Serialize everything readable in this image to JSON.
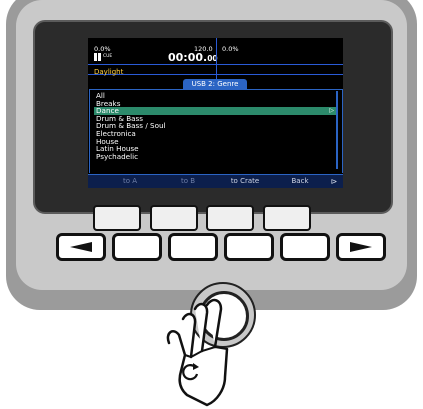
{
  "deck": {
    "left_pct": "0.0%",
    "time": "00:00.",
    "time_ms": "00",
    "bpm": "120.0",
    "right_pct": "0.0%",
    "cue_label": "CUE",
    "track_name": "Daylight"
  },
  "browser": {
    "tab_label": "USB 2: Genre",
    "items": [
      "All",
      "Breaks",
      "Dance",
      "Drum & Bass",
      "Drum & Bass / Soul",
      "Electronica",
      "House",
      "Latin House",
      "Psychadelic"
    ],
    "selected_index": 2,
    "selected_arrow": "▷"
  },
  "softkeys": [
    "to A",
    "to B",
    "to Crate",
    "Back",
    "⊳"
  ],
  "colors": {
    "accent": "#2b64c4",
    "selected_row": "#2c8a6b",
    "softkey_bar": "#0c1f4c"
  },
  "icons": {
    "play_pause": "play-pause-icon",
    "left_arrow": "left-arrow-icon",
    "right_arrow": "right-arrow-icon",
    "rotate": "rotate-icon",
    "hand": "hand-icon"
  }
}
